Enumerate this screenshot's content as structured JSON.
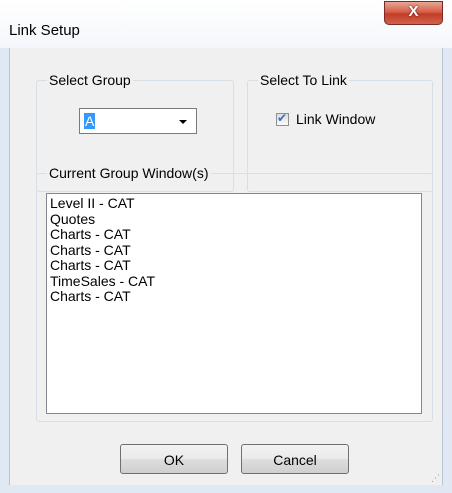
{
  "window": {
    "title": "Link Setup",
    "close_glyph": "X"
  },
  "select_group": {
    "legend": "Select Group",
    "selected_value": "A"
  },
  "select_to_link": {
    "legend": "Select To Link",
    "checkbox_label": "Link Window",
    "checked": true
  },
  "current_group": {
    "legend": "Current Group Window(s)",
    "items": [
      "Level II - CAT",
      "Quotes",
      "Charts - CAT",
      "Charts - CAT",
      "Charts - CAT",
      "TimeSales - CAT",
      "Charts - CAT"
    ]
  },
  "buttons": {
    "ok_label": "OK",
    "cancel_label": "Cancel"
  },
  "colors": {
    "selection": "#3399ff",
    "close_button": "#c33d25",
    "checkmark": "#3c6db5"
  },
  "icons": {
    "close": "close-icon",
    "dropdown": "chevron-down-icon",
    "check": "checkmark-icon",
    "grip": "resize-grip-icon"
  }
}
